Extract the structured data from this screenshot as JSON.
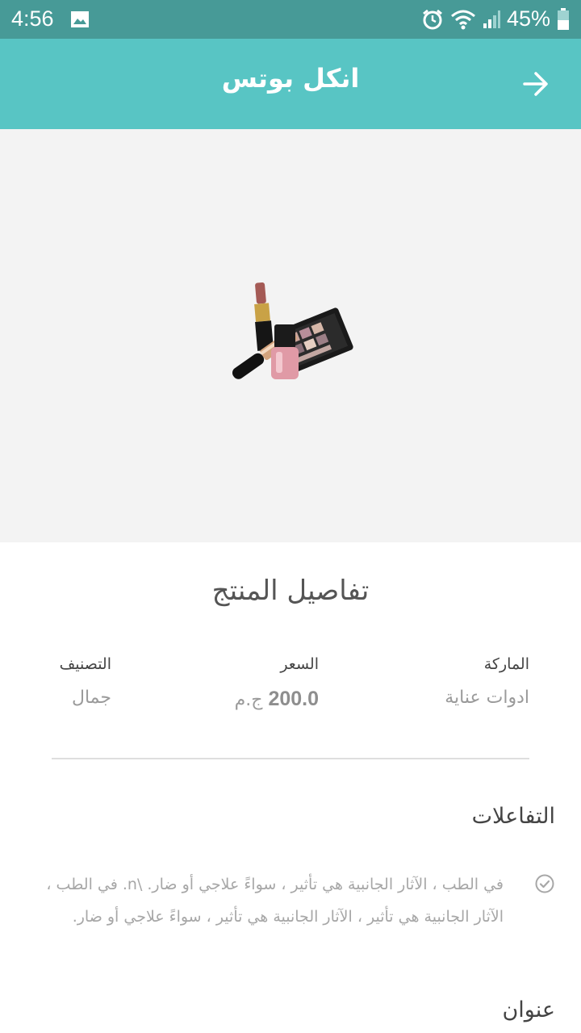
{
  "status_bar": {
    "time": "4:56",
    "battery": "45%",
    "icons": [
      "image-icon",
      "alarm-icon",
      "wifi-icon",
      "signal-icon",
      "battery-icon"
    ]
  },
  "app_bar": {
    "title": "انكل بوتس",
    "back_icon": "arrow-right-icon"
  },
  "product": {
    "image_icon": "cosmetics-image"
  },
  "details": {
    "title": "تفاصيل المنتج",
    "brand_label": "الماركة",
    "brand_value": "ادوات عناية",
    "price_label": "السعر",
    "price_value": "200.0",
    "price_currency": "ج.م",
    "category_label": "التصنيف",
    "category_value": "جمال"
  },
  "interactions": {
    "heading": "التفاعلات",
    "text": "في الطب ، الآثار الجانبية هي تأثير ، سواءً علاجي أو ضار. \\n.  في الطب ، الآثار الجانبية هي تأثير ، الآثار الجانبية هي تأثير ، سواءً علاجي أو ضار."
  },
  "address": {
    "heading": "عنوان"
  },
  "colors": {
    "status_bar": "#479a97",
    "app_bar": "#58c5c4",
    "hero_bg": "#f3f3f3"
  }
}
